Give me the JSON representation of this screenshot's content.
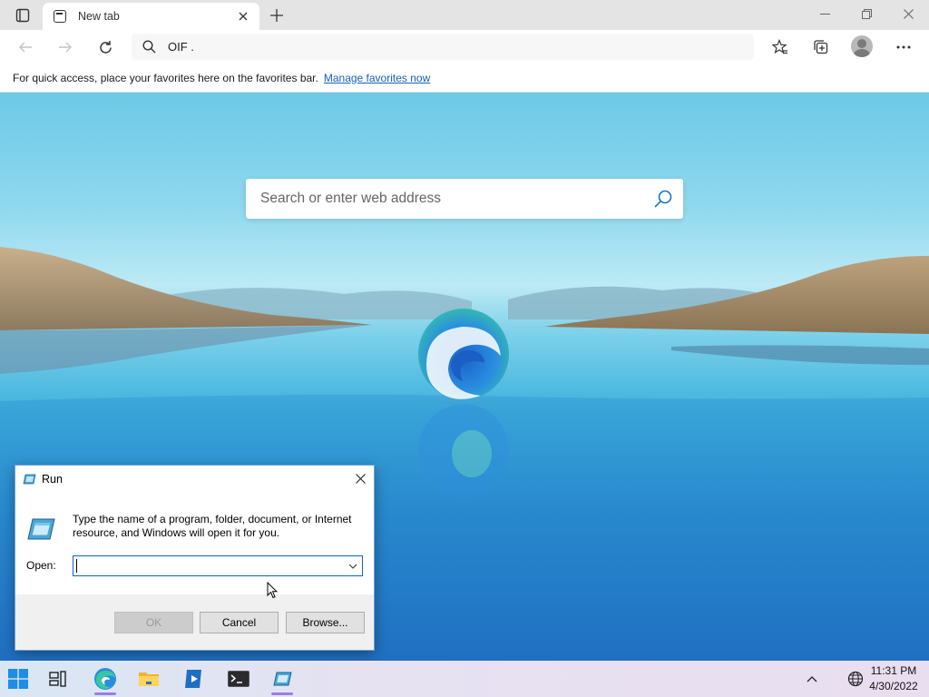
{
  "browser": {
    "tab": {
      "title": "New tab"
    },
    "address_bar": {
      "value": "OIF ."
    },
    "favorites_bar": {
      "message": "For quick access, place your favorites here on the favorites bar.",
      "link": "Manage favorites now"
    }
  },
  "new_tab_page": {
    "search_placeholder": "Search or enter web address"
  },
  "run_dialog": {
    "title": "Run",
    "description": "Type the name of a program, folder, document, or Internet resource, and Windows will open it for you.",
    "open_label": "Open:",
    "open_value": "",
    "buttons": {
      "ok": "OK",
      "cancel": "Cancel",
      "browse": "Browse..."
    }
  },
  "taskbar": {
    "apps": [
      "start-icon",
      "task-view-icon",
      "edge-icon",
      "file-explorer-icon",
      "media-player-icon",
      "terminal-icon",
      "run-icon"
    ],
    "clock": {
      "time": "11:31 PM",
      "date": "4/30/2022"
    }
  },
  "colors": {
    "accent": "#0a64c8",
    "link": "#1560bd",
    "taskbar_active": "#9a7fe0"
  }
}
